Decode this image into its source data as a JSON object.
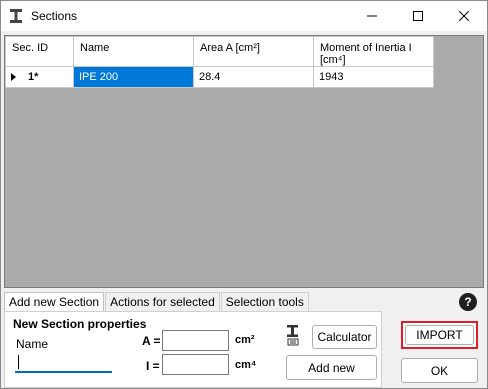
{
  "window": {
    "title": "Sections",
    "icon": "i-beam-section-icon"
  },
  "grid": {
    "columns": [
      "Sec. ID",
      "Name",
      "Area A [cm²]",
      "Moment of Inertia I [cm⁴]"
    ],
    "column_moi_line1": "Moment of Inertia I",
    "column_moi_line2": "[cm⁴]",
    "rows": [
      {
        "id": "1*",
        "name": "IPE 200",
        "area": "28.4",
        "moi": "1943",
        "selected_cell": "name"
      }
    ]
  },
  "tabs": [
    {
      "label": "Add new Section",
      "active": true
    },
    {
      "label": "Actions for selected",
      "active": false
    },
    {
      "label": "Selection tools",
      "active": false
    }
  ],
  "panel": {
    "title": "New Section properties",
    "name_label": "Name",
    "name_value": "",
    "area_label": "A =",
    "area_unit": "cm²",
    "area_value": "",
    "inertia_label": "I =",
    "inertia_unit": "cm⁴",
    "inertia_value": "",
    "calculator_button": "Calculator",
    "add_button": "Add new"
  },
  "actions": {
    "import_button": "IMPORT",
    "ok_button": "OK",
    "help": "?"
  },
  "colors": {
    "selection": "#0078d7",
    "highlight_border": "#e11d2c",
    "grid_background": "#ababab"
  }
}
